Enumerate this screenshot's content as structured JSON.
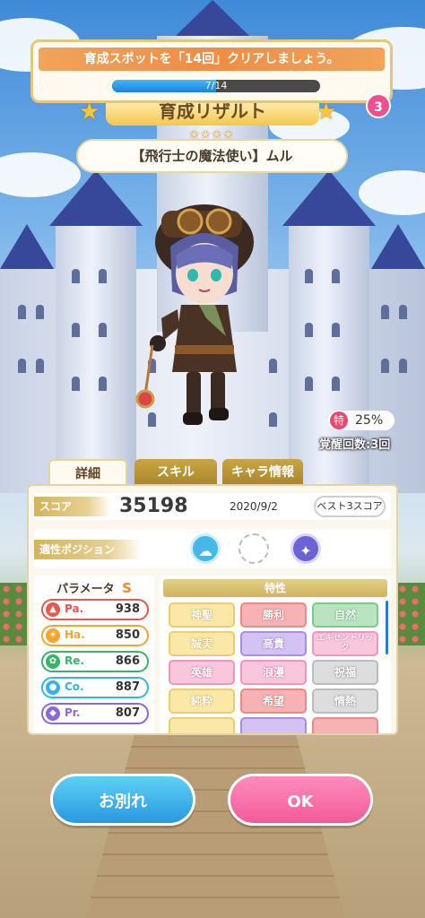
{
  "quest": {
    "text": "育成スポットを「14回」クリアしましょう。",
    "progress_label": "7/14",
    "progress_fraction": 0.5,
    "badge": "3"
  },
  "header": {
    "title": "育成リザルト",
    "rarity": "★★★★",
    "character_name": "【飛行士の魔法使い】ムル"
  },
  "status": {
    "ratio_icon": "特",
    "ratio": "25%",
    "awaken": "覚醒回数:3回"
  },
  "tabs": [
    {
      "label": "詳細",
      "active": true
    },
    {
      "label": "スキル",
      "active": false
    },
    {
      "label": "キャラ情報",
      "active": false
    }
  ],
  "score": {
    "label": "スコア",
    "value": "35198",
    "date": "2020/9/2",
    "best_button": "ベスト3スコア"
  },
  "position": {
    "label": "適性ポジション"
  },
  "params": {
    "title": "パラメータ",
    "rank": "S",
    "items": [
      {
        "name": "Pa.",
        "value": "938",
        "color": "#e9574b"
      },
      {
        "name": "Ha.",
        "value": "850",
        "color": "#f4a52f"
      },
      {
        "name": "Re.",
        "value": "866",
        "color": "#38b46a"
      },
      {
        "name": "Co.",
        "value": "887",
        "color": "#35b2e6"
      },
      {
        "name": "Pr.",
        "value": "807",
        "color": "#8c67d9"
      }
    ]
  },
  "traits": {
    "title": "特性",
    "items": [
      "神聖",
      "勝利",
      "自然",
      "誠実",
      "高貴",
      "エキセントリック",
      "英雄",
      "浪漫",
      "祝福",
      "純粋",
      "希望",
      "情熱"
    ]
  },
  "buttons": {
    "farewell": "お別れ",
    "ok": "OK"
  }
}
